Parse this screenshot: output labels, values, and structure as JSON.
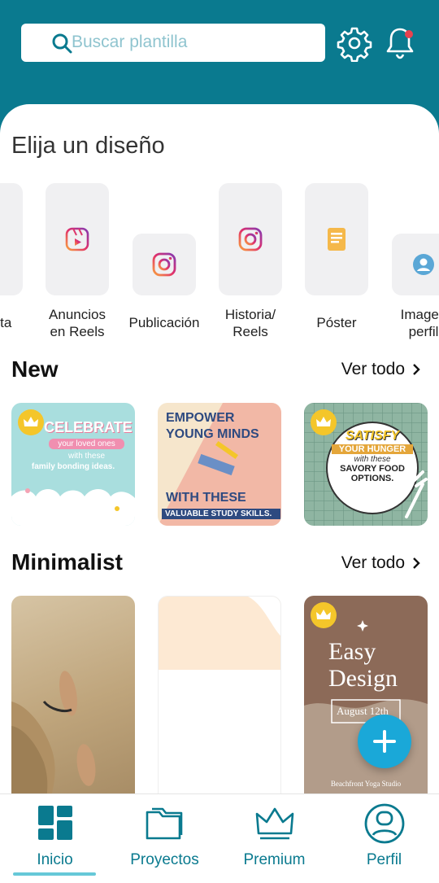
{
  "search": {
    "placeholder": "Buscar plantilla"
  },
  "section_title": "Elija un diseño",
  "categories": [
    {
      "label": "sta",
      "icon": "blank-icon"
    },
    {
      "label": "Anuncios\nen Reels",
      "icon": "reels-icon"
    },
    {
      "label": "Publicación",
      "icon": "instagram-icon"
    },
    {
      "label": "Historia/\nReels",
      "icon": "instagram-icon"
    },
    {
      "label": "Póster",
      "icon": "poster-icon"
    },
    {
      "label": "Imagen\nperfil",
      "icon": "profile-avatar-icon"
    }
  ],
  "new_section": {
    "title": "New",
    "see_all": "Ver todo",
    "cards": [
      {
        "lines": [
          "CELEBRATE",
          "your loved ones",
          "with these",
          "family bonding ideas."
        ]
      },
      {
        "lines": [
          "EMPOWER",
          "YOUNG MINDS",
          "WITH THESE",
          "VALUABLE STUDY SKILLS."
        ]
      },
      {
        "lines": [
          "SATISFY",
          "YOUR HUNGER",
          "with these",
          "SAVORY FOOD",
          "OPTIONS."
        ]
      }
    ]
  },
  "minimalist_section": {
    "title": "Minimalist",
    "see_all": "Ver todo",
    "cards": [
      {
        "lines": []
      },
      {
        "lines": []
      },
      {
        "lines": [
          "Easy",
          "Design",
          "August 12th",
          "Beachfront Yoga Studio"
        ]
      }
    ]
  },
  "nav": [
    {
      "label": "Inicio",
      "icon": "home-grid-icon",
      "active": true
    },
    {
      "label": "Proyectos",
      "icon": "folder-icon",
      "active": false
    },
    {
      "label": "Premium",
      "icon": "crown-icon",
      "active": false
    },
    {
      "label": "Perfil",
      "icon": "profile-icon",
      "active": false
    }
  ],
  "colors": {
    "brand": "#0a7a8f",
    "accent_fab": "#1aa8d8",
    "crown": "#f4c62a",
    "notification_dot": "#e8424f"
  }
}
